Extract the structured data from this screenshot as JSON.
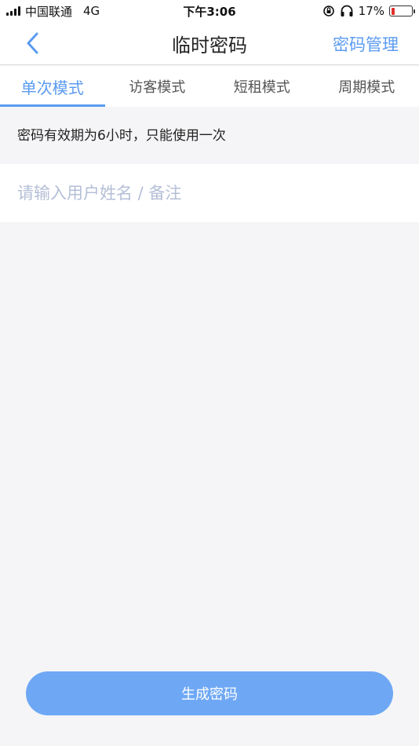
{
  "status_bar": {
    "carrier": "中国联通",
    "network": "4G",
    "time": "下午3:06",
    "battery_percent": "17%",
    "battery_level": 0.17,
    "battery_color": "#e0312b"
  },
  "nav": {
    "back_icon": "chevron-left-icon",
    "title": "临时密码",
    "action_label": "密码管理"
  },
  "tabs": [
    {
      "label": "单次模式",
      "active": true
    },
    {
      "label": "访客模式",
      "active": false
    },
    {
      "label": "短租模式",
      "active": false
    },
    {
      "label": "周期模式",
      "active": false
    }
  ],
  "info": {
    "text": "密码有效期为6小时，只能使用一次"
  },
  "form": {
    "name_placeholder": "请输入用户姓名 / 备注",
    "name_value": ""
  },
  "footer": {
    "generate_label": "生成密码"
  },
  "colors": {
    "accent": "#5b9bf0",
    "button": "#6ea8f5",
    "background": "#f5f5f7",
    "placeholder": "#b4bfd6"
  }
}
